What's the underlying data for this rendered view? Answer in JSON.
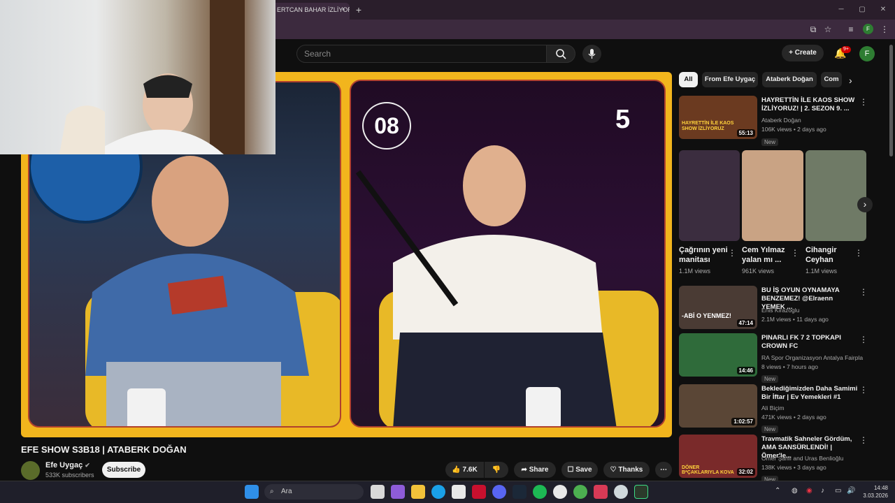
{
  "browser": {
    "tab_title": "ERTCAN BAHAR İZLİYOR",
    "new_tab": "+",
    "close_tab": "×"
  },
  "header": {
    "search_placeholder": "Search",
    "create_label": "Create",
    "notification_count": "9+",
    "avatar_letter": "F",
    "profile_letter": "F"
  },
  "video": {
    "counter_left": "08",
    "counter_right": "5",
    "title": "EFE SHOW S3B18 | ATABERK DOĞAN",
    "channel": "Efe Uygaç",
    "subscribers": "533K subscribers",
    "subscribe_label": "Subscribe",
    "likes": "7.6K",
    "share_label": "Share",
    "save_label": "Save",
    "thanks_label": "Thanks"
  },
  "chips": [
    "All",
    "From Efe Uygaç",
    "Ataberk Doğan",
    "Com"
  ],
  "recommended": [
    {
      "title": "HAYRETTİN İLE KAOS SHOW İZLİYORUZ! | 2. SEZON 9. ...",
      "channel": "Ataberk Doğan",
      "meta": "106K views • 2 days ago",
      "badge": "New",
      "duration": "55:13",
      "thumb_text": "HAYRETTİN İLE KAOS SHOW İZLİYORUZ",
      "thumb_color": "#6b3a20"
    },
    {
      "title": "BU İŞ OYUN OYNAMAYA BENZEMEZ! @Elraenn YEMEK ...",
      "channel": "Enis Kirazoglu",
      "meta": "2.1M views • 11 days ago",
      "badge": "",
      "duration": "47:14",
      "thumb_text": "-ABİ O YENMEZ!",
      "thumb_color": "#4a3b34"
    },
    {
      "title": "PINARLI FK 7 2 TOPKAPI CROWN FC",
      "channel": "RA Spor Organizasyon Antalya Fairplaylig",
      "meta": "8 views • 7 hours ago",
      "badge": "New",
      "duration": "14:46",
      "thumb_text": "",
      "thumb_color": "#2f6b3a"
    },
    {
      "title": "Beklediğimizden Daha Samimi Bir İftar | Ev Yemekleri #1",
      "channel": "Ali Biçim",
      "meta": "471K views • 2 days ago",
      "badge": "New",
      "duration": "1:02:57",
      "thumb_text": "",
      "thumb_color": "#5a4636"
    },
    {
      "title": "Travmatik Sahneler Gördüm, AMA SANSÜRLENDİ! | Ömer'le...",
      "channel": "Ömer Şanlı and Uras Benlioğlu",
      "meta": "138K views • 3 days ago",
      "badge": "New",
      "duration": "32:02",
      "thumb_text": "DÖNER B*ÇAKLARIYLA KOVA",
      "thumb_color": "#7a2a2a"
    }
  ],
  "shorts": [
    {
      "title": "Çağrının yeni manitası",
      "views": "1.1M views",
      "thumb_color": "#3b2d3f"
    },
    {
      "title": "Cem Yılmaz yalan mı ...",
      "views": "961K views",
      "thumb_color": "#c9a384"
    },
    {
      "title": "Cihangir Ceyhan",
      "views": "1.1M views",
      "thumb_color": "#6f7a66"
    }
  ],
  "taskbar": {
    "search_label": "Ara",
    "time": "14:48",
    "date": "3.03.2026"
  }
}
